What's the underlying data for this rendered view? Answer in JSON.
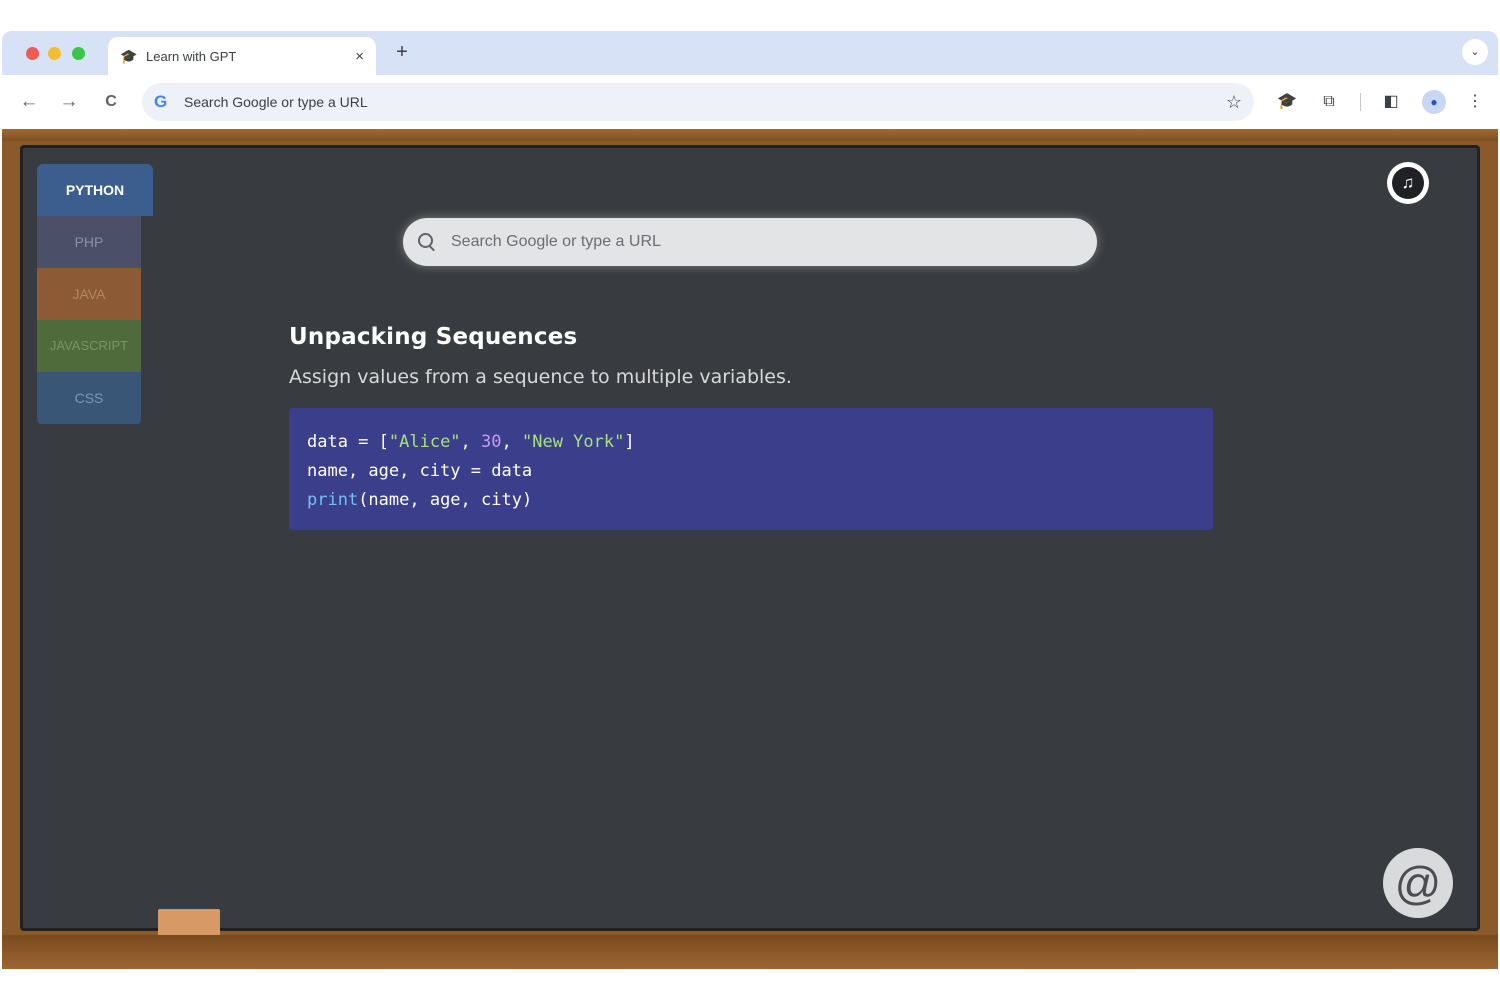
{
  "browser": {
    "tab": {
      "title": "Learn with GPT",
      "favicon": "graduation-cap-icon",
      "close": "×"
    },
    "new_tab": "+",
    "tab_menu": "⌄",
    "nav": {
      "back": "←",
      "forward": "→",
      "reload": "C"
    },
    "omnibox": {
      "google_letter": "G",
      "text": "Search Google or type a URL",
      "star": "☆"
    },
    "extensions": {
      "ext1": "🎓",
      "puzzle": "⧉",
      "sidepanel": "◧",
      "avatar": "●",
      "menu": "⋮"
    }
  },
  "page": {
    "languages": [
      {
        "label": "PYTHON",
        "active": true
      },
      {
        "label": "PHP",
        "active": false
      },
      {
        "label": "JAVA",
        "active": false
      },
      {
        "label": "JAVASCRIPT",
        "active": false
      },
      {
        "label": "CSS",
        "active": false
      }
    ],
    "music_icon": "♫",
    "search": {
      "placeholder": "Search Google or type a URL"
    },
    "lesson": {
      "title": "Unpacking Sequences",
      "description": "Assign values from a sequence to multiple variables.",
      "code": {
        "line1": {
          "a": "data = [",
          "s1": "\"Alice\"",
          "b": ", ",
          "n1": "30",
          "c": ", ",
          "s2": "\"New York\"",
          "d": "]"
        },
        "line2": "name, age, city = data",
        "line3": {
          "fn": "print",
          "rest": "(name, age, city)"
        }
      }
    },
    "logo_glyph": "@"
  },
  "colors": {
    "board": "#383b3f",
    "frame": "#8b5a2b",
    "code_bg": "#3b3e8a",
    "python_tab": "#3c5e8f"
  }
}
